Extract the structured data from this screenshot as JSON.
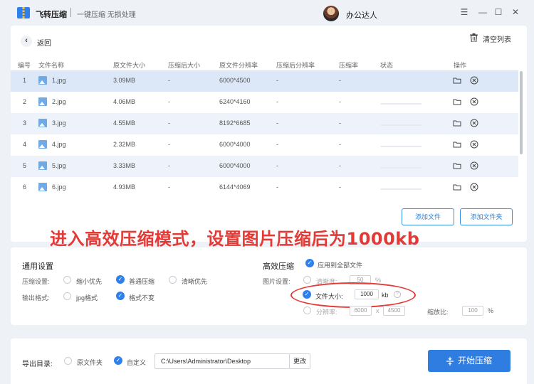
{
  "app": {
    "title": "飞转压缩",
    "subtitle": "一键压缩 无损处理",
    "user": "办公达人"
  },
  "window": {
    "menu_glyph": "☰",
    "minimize_glyph": "—",
    "maximize_glyph": "☐",
    "close_glyph": "✕"
  },
  "toolbar": {
    "back_label": "返回",
    "back_glyph": "‹",
    "clear_label": "清空列表"
  },
  "table": {
    "headers": [
      "编号",
      "文件名称",
      "原文件大小",
      "压缩后大小",
      "原文件分辨率",
      "压缩后分辨率",
      "压缩率",
      "状态",
      "操作"
    ],
    "rows": [
      {
        "num": "1",
        "name": "1.jpg",
        "size": "3.09MB",
        "after": "-",
        "res": "6000*4500",
        "after_res": "-",
        "rate": "-"
      },
      {
        "num": "2",
        "name": "2.jpg",
        "size": "4.06MB",
        "after": "-",
        "res": "6240*4160",
        "after_res": "-",
        "rate": "-"
      },
      {
        "num": "3",
        "name": "3.jpg",
        "size": "4.55MB",
        "after": "-",
        "res": "8192*6685",
        "after_res": "-",
        "rate": "-"
      },
      {
        "num": "4",
        "name": "4.jpg",
        "size": "2.32MB",
        "after": "-",
        "res": "6000*4000",
        "after_res": "-",
        "rate": "-"
      },
      {
        "num": "5",
        "name": "5.jpg",
        "size": "3.33MB",
        "after": "-",
        "res": "6000*4000",
        "after_res": "-",
        "rate": "-"
      },
      {
        "num": "6",
        "name": "6.jpg",
        "size": "4.93MB",
        "after": "-",
        "res": "6144*4069",
        "after_res": "-",
        "rate": "-"
      }
    ]
  },
  "buttons": {
    "add_file": "添加文件",
    "add_folder": "添加文件夹"
  },
  "annotation": "进入高效压缩模式，设置图片压缩后为1000kb",
  "general": {
    "title": "通用设置",
    "compress_label": "压缩设置:",
    "compress_options": [
      "缩小优先",
      "普通压缩",
      "清晰优先"
    ],
    "format_label": "输出格式:",
    "format_options": [
      "jpg格式",
      "格式不变"
    ]
  },
  "efficient": {
    "title": "高效压缩",
    "apply_all": "应用到全部文件",
    "image_label": "图片设置:",
    "clarity_label": "清晰度:",
    "clarity_value": "50",
    "clarity_unit": "%",
    "filesize_label": "文件大小:",
    "filesize_value": "1000",
    "filesize_unit": "kb",
    "info_glyph": "?",
    "resolution_label": "分辨率:",
    "res_w": "6000",
    "res_sep": "x",
    "res_h": "4500",
    "scale_label": "缩放比:",
    "scale_value": "100",
    "scale_unit": "%"
  },
  "export": {
    "label": "导出目录:",
    "options": [
      "原文件夹",
      "自定义"
    ],
    "path": "C:\\Users\\Administrator\\Desktop",
    "change": "更改",
    "start": "开始压缩"
  },
  "colors": {
    "accent": "#2f80ed",
    "annotation": "#e53935",
    "selected_row": "#dce8f8"
  }
}
